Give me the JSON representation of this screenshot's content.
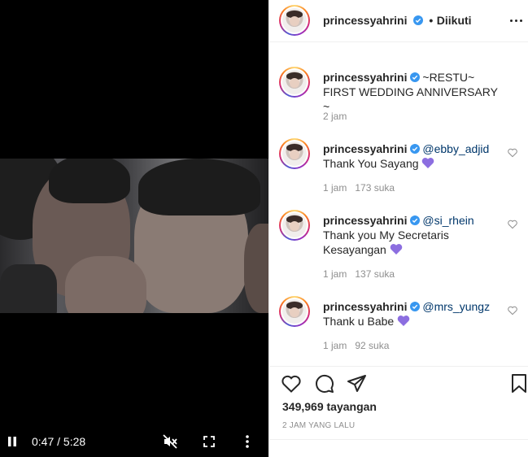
{
  "post": {
    "username": "princessyahrini",
    "follow_sep": "•",
    "follow_status": "Diikuti",
    "caption": "~RESTU~ FIRST WEDDING ANNIVERSARY ~",
    "caption_time": "2 jam"
  },
  "video": {
    "time_display": "0:47 / 5:28",
    "icons": [
      "pause-icon",
      "muted-icon",
      "fullscreen-icon",
      "more-vertical-icon"
    ]
  },
  "comments": [
    {
      "username": "princessyahrini",
      "mention": "@ebby_adjid",
      "text": "Thank You Sayang",
      "emoji": "purple-heart",
      "time": "1 jam",
      "likes": "173 suka"
    },
    {
      "username": "princessyahrini",
      "mention": "@si_rhein",
      "text": "Thank you My Secretaris Kesayangan",
      "emoji": "purple-heart",
      "time": "1 jam",
      "likes": "137 suka"
    },
    {
      "username": "princessyahrini",
      "mention": "@mrs_yungz",
      "text": "Thank u Babe",
      "emoji": "purple-heart",
      "time": "1 jam",
      "likes": "92 suka"
    }
  ],
  "stats": {
    "views": "349,969 tayangan",
    "posted_ago": "2 JAM YANG LALU"
  },
  "colors": {
    "verified": "#3897f0",
    "purple_heart": "#8c6ee0",
    "link": "#00376b",
    "muted_text": "#8e8e8e"
  }
}
